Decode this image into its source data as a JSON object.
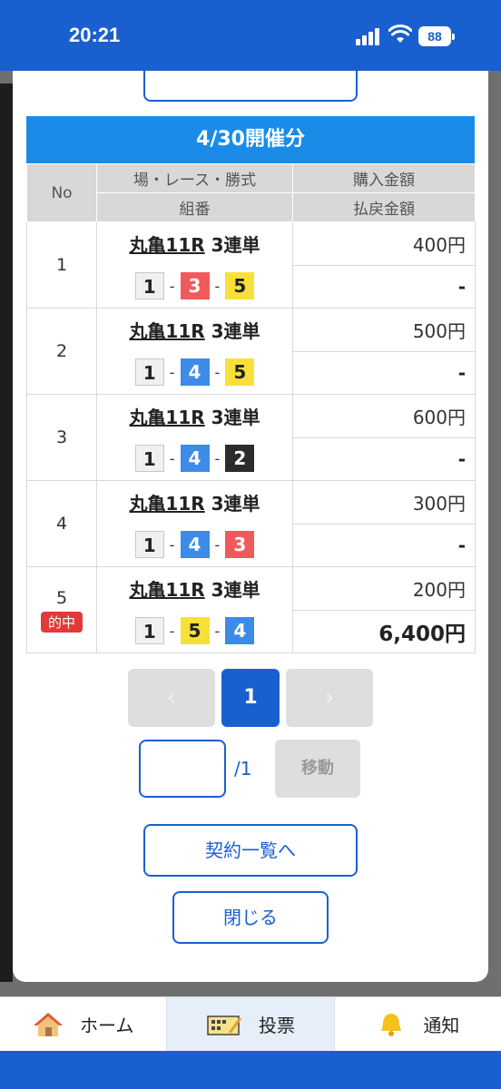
{
  "status": {
    "time": "20:21",
    "battery": "88"
  },
  "section": {
    "date_label": "4/30開催分"
  },
  "table": {
    "headers": {
      "no": "No",
      "race": "場・レース・勝式",
      "combo": "組番",
      "purchase": "購入金額",
      "payout": "払戻金額"
    },
    "rows": [
      {
        "no": "1",
        "venue": "丸亀11R",
        "bet_type": "3連単",
        "combo": [
          "1",
          "3",
          "5"
        ],
        "purchase": "400円",
        "payout": "-",
        "hit": ""
      },
      {
        "no": "2",
        "venue": "丸亀11R",
        "bet_type": "3連単",
        "combo": [
          "1",
          "4",
          "5"
        ],
        "purchase": "500円",
        "payout": "-",
        "hit": ""
      },
      {
        "no": "3",
        "venue": "丸亀11R",
        "bet_type": "3連単",
        "combo": [
          "1",
          "4",
          "2"
        ],
        "purchase": "600円",
        "payout": "-",
        "hit": ""
      },
      {
        "no": "4",
        "venue": "丸亀11R",
        "bet_type": "3連単",
        "combo": [
          "1",
          "4",
          "3"
        ],
        "purchase": "300円",
        "payout": "-",
        "hit": ""
      },
      {
        "no": "5",
        "venue": "丸亀11R",
        "bet_type": "3連単",
        "combo": [
          "1",
          "5",
          "4"
        ],
        "purchase": "200円",
        "payout": "6,400円",
        "hit": "的中"
      }
    ]
  },
  "pager": {
    "prev": "‹",
    "current": "1",
    "next": "›",
    "total": "/1",
    "jump_label": "移動",
    "jump_value": ""
  },
  "buttons": {
    "contracts": "契約一覧へ",
    "close": "閉じる"
  },
  "nav": [
    {
      "label": "ホーム",
      "icon": "home-icon",
      "active": false
    },
    {
      "label": "投票",
      "icon": "ticket-icon",
      "active": true
    },
    {
      "label": "通知",
      "icon": "bell-icon",
      "active": false
    }
  ],
  "colors": {
    "brand": "#1a5fd0",
    "header": "#1a8ce8",
    "hit": "#e23a3a",
    "boat1": "#f0f0f0",
    "boat2": "#2b2b2b",
    "boat3": "#f05a5a",
    "boat4": "#3d8be8",
    "boat5": "#f7e03a"
  }
}
